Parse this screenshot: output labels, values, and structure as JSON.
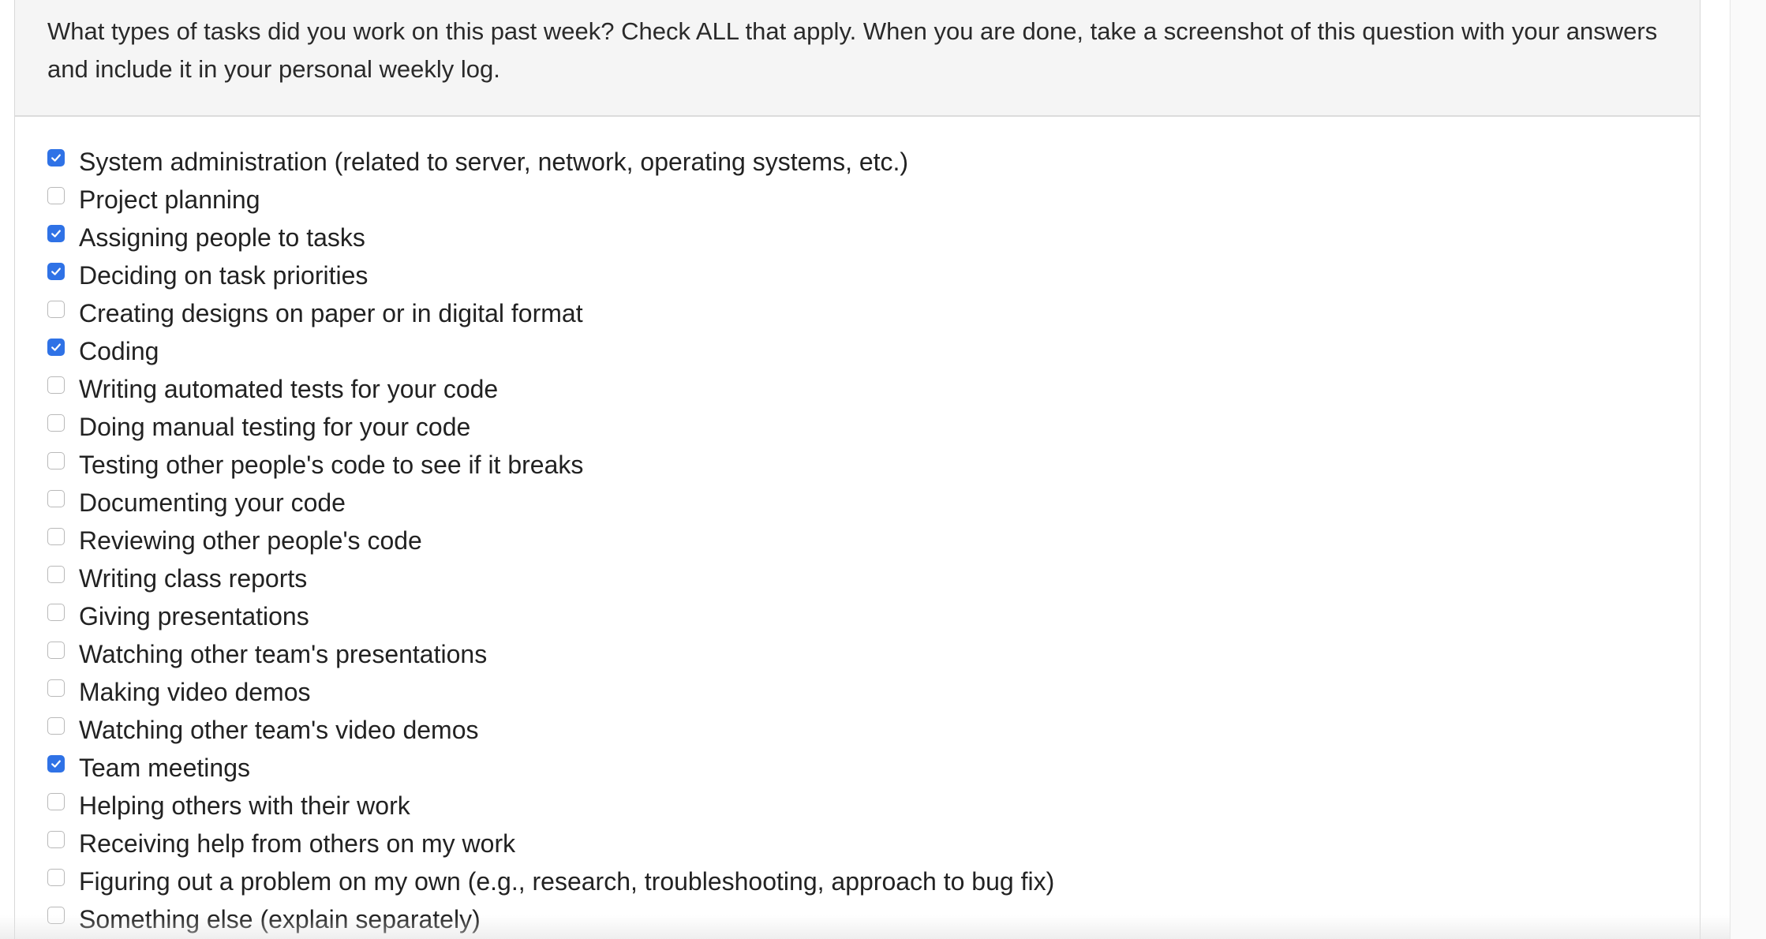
{
  "question": {
    "text": "What types of tasks did you work on this past week? Check ALL that apply. When you are done, take a screenshot of this question with your answers and include it in your personal weekly log."
  },
  "accent_color": "#2f72e6",
  "options": [
    {
      "label": "System administration (related to server, network, operating systems, etc.)",
      "checked": true
    },
    {
      "label": "Project planning",
      "checked": false
    },
    {
      "label": "Assigning people to tasks",
      "checked": true
    },
    {
      "label": "Deciding on task priorities",
      "checked": true
    },
    {
      "label": "Creating designs on paper or in digital format",
      "checked": false
    },
    {
      "label": "Coding",
      "checked": true
    },
    {
      "label": "Writing automated tests for your code",
      "checked": false
    },
    {
      "label": "Doing manual testing for your code",
      "checked": false
    },
    {
      "label": "Testing other people's code to see if it breaks",
      "checked": false
    },
    {
      "label": "Documenting your code",
      "checked": false
    },
    {
      "label": "Reviewing other people's code",
      "checked": false
    },
    {
      "label": "Writing class reports",
      "checked": false
    },
    {
      "label": "Giving presentations",
      "checked": false
    },
    {
      "label": "Watching other team's presentations",
      "checked": false
    },
    {
      "label": "Making video demos",
      "checked": false
    },
    {
      "label": "Watching other team's video demos",
      "checked": false
    },
    {
      "label": "Team meetings",
      "checked": true
    },
    {
      "label": "Helping others with their work",
      "checked": false
    },
    {
      "label": "Receiving help from others on my work",
      "checked": false
    },
    {
      "label": "Figuring out a problem on my own (e.g., research, troubleshooting, approach to bug fix)",
      "checked": false
    },
    {
      "label": "Something else (explain separately)",
      "checked": false
    }
  ]
}
